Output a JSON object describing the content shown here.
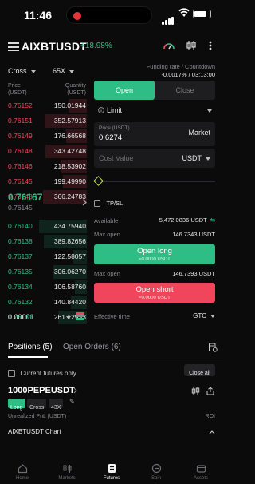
{
  "status_bar": {
    "time": "11:46"
  },
  "header": {
    "pair": "AIXBTUSDT",
    "change": "+18.98%"
  },
  "controls": {
    "margin_mode": "Cross",
    "leverage": "65X",
    "funding_label": "Funding rate / Countdown",
    "funding_value": "-0.0017% / 03:13:00"
  },
  "orderbook": {
    "price_label": "Price",
    "price_unit": "(USDT)",
    "qty_label": "Quantity",
    "qty_unit": "(USDT)",
    "asks": [
      {
        "price": "0.76152",
        "qty": "150.01944",
        "depth": 0.38
      },
      {
        "price": "0.76151",
        "qty": "352.57913",
        "depth": 0.88
      },
      {
        "price": "0.76149",
        "qty": "176.66568",
        "depth": 0.44
      },
      {
        "price": "0.76148",
        "qty": "343.42748",
        "depth": 0.86
      },
      {
        "price": "0.76146",
        "qty": "218.53902",
        "depth": 0.55
      },
      {
        "price": "0.76145",
        "qty": "199.49990",
        "depth": 0.5
      },
      {
        "price": "0.76143",
        "qty": "366.24783",
        "depth": 0.92
      }
    ],
    "last_price": "0.76167",
    "mark_price": "0.76145",
    "bids": [
      {
        "price": "0.76140",
        "qty": "434.75940",
        "depth": 1.0
      },
      {
        "price": "0.76138",
        "qty": "389.82656",
        "depth": 0.9
      },
      {
        "price": "0.76137",
        "qty": "122.58057",
        "depth": 0.28
      },
      {
        "price": "0.76135",
        "qty": "306.06270",
        "depth": 0.7
      },
      {
        "price": "0.76134",
        "qty": "106.58760",
        "depth": 0.25
      },
      {
        "price": "0.76132",
        "qty": "140.84420",
        "depth": 0.33
      },
      {
        "price": "0.76131",
        "qty": "261.12933",
        "depth": 0.6
      }
    ],
    "precision": "0.00001"
  },
  "form": {
    "tab_open": "Open",
    "tab_close": "Close",
    "order_type": "Limit",
    "price_label": "Price (USDT)",
    "price_value": "0.6274",
    "price_mode": "Market",
    "cost_label": "Cost Value",
    "cost_unit": "USDT",
    "tpsl_label": "TP/SL",
    "available_label": "Available",
    "available_value": "5,472.0836 USDT",
    "max_open_label": "Max open",
    "max_open_long": "146.7343 USDT",
    "open_long_label": "Open long",
    "open_long_sub": "≈0.0000 USDT",
    "max_open_short": "146.7393 USDT",
    "open_short_label": "Open short",
    "open_short_sub": "≈0.0000 USDT",
    "effective_label": "Effective time",
    "effective_value": "GTC"
  },
  "positions": {
    "tab_positions": "Positions (5)",
    "tab_orders": "Open Orders (6)",
    "current_only": "Current futures only",
    "close_all": "Close all",
    "symbol": "1000PEPEUSDT",
    "side": "Long",
    "mode": "Cross",
    "leverage": "43X",
    "unrealized_label": "Unrealized PnL (USDT)",
    "roi_label": "ROI"
  },
  "chart_bar": {
    "label": "AIXBTUSDT Chart"
  },
  "nav": [
    {
      "label": "Home"
    },
    {
      "label": "Markets"
    },
    {
      "label": "Futures"
    },
    {
      "label": "Spin"
    },
    {
      "label": "Assets"
    }
  ],
  "colors": {
    "ask": "#f0455a",
    "bid": "#2ebd85",
    "accent": "#2ebd85"
  }
}
